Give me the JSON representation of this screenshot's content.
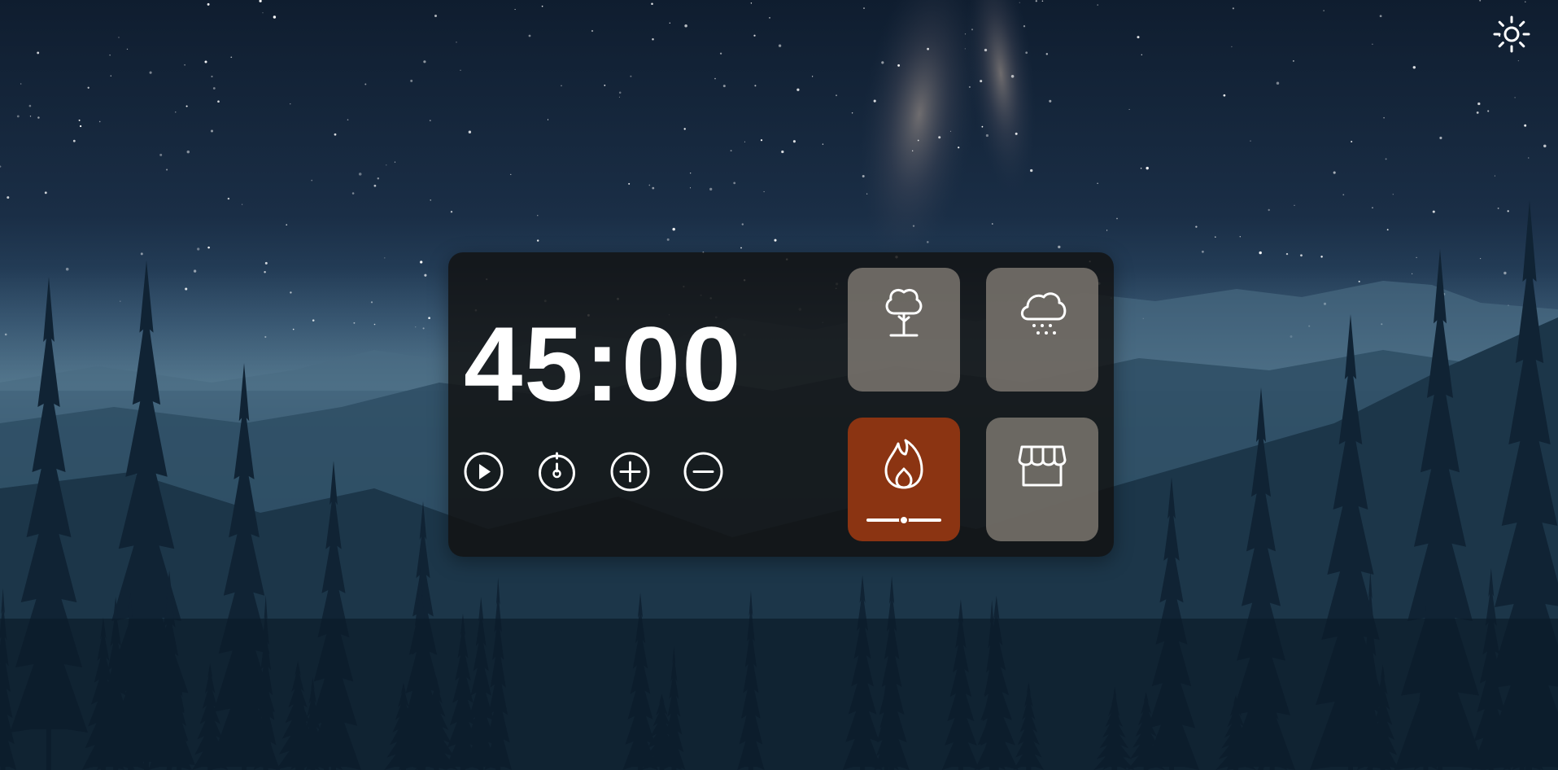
{
  "timer": {
    "display": "45:00"
  },
  "controls": [
    {
      "name": "play-button",
      "icon": "play-icon"
    },
    {
      "name": "stopwatch-button",
      "icon": "stopwatch-icon"
    },
    {
      "name": "increase-button",
      "icon": "plus-circle-icon"
    },
    {
      "name": "decrease-button",
      "icon": "minus-circle-icon"
    }
  ],
  "sounds": [
    {
      "name": "forest",
      "icon": "tree-icon",
      "active": false
    },
    {
      "name": "rain",
      "icon": "cloud-rain-icon",
      "active": false
    },
    {
      "name": "fire",
      "icon": "flame-icon",
      "active": true,
      "volume": 0.5
    },
    {
      "name": "cafe",
      "icon": "storefront-icon",
      "active": false
    }
  ],
  "header": {
    "theme_icon": "sun-icon"
  },
  "colors": {
    "panel": "#121212",
    "tile": "#847e76",
    "active_tile": "#8b3412",
    "text": "#ffffff"
  }
}
